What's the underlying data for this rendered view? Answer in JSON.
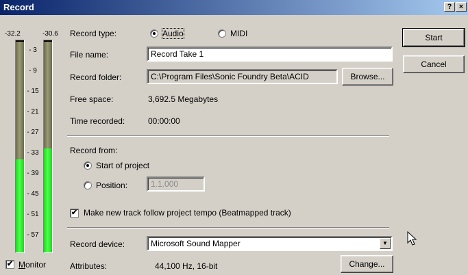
{
  "window": {
    "title": "Record",
    "help_label": "?",
    "close_label": "×"
  },
  "meter": {
    "left_peak": "-32.2",
    "right_peak": "-30.6",
    "ticks": [
      "3",
      "9",
      "15",
      "21",
      "27",
      "33",
      "39",
      "45",
      "51",
      "57"
    ],
    "left_level": 0.44,
    "right_level": 0.49
  },
  "monitor": {
    "label": "Monitor",
    "checked": true
  },
  "record_type": {
    "label": "Record type:",
    "options": [
      "Audio",
      "MIDI"
    ],
    "selected": "Audio"
  },
  "file_name": {
    "label": "File name:",
    "value": "Record Take 1"
  },
  "record_folder": {
    "label": "Record folder:",
    "value": "C:\\Program Files\\Sonic Foundry Beta\\ACID",
    "browse_label": "Browse..."
  },
  "free_space": {
    "label": "Free space:",
    "value": "3,692.5 Megabytes"
  },
  "time_recorded": {
    "label": "Time recorded:",
    "value": "00:00:00"
  },
  "record_from": {
    "label": "Record from:",
    "start_label": "Start of project",
    "position_label": "Position:",
    "position_value": "1.1.000",
    "selected": "start"
  },
  "tempo_check": {
    "label": "Make new track follow project tempo (Beatmapped track)",
    "checked": true
  },
  "record_device": {
    "label": "Record device:",
    "value": "Microsoft Sound Mapper"
  },
  "attributes": {
    "label": "Attributes:",
    "value": "44,100 Hz, 16-bit",
    "change_label": "Change..."
  },
  "buttons": {
    "start": "Start",
    "cancel": "Cancel"
  }
}
